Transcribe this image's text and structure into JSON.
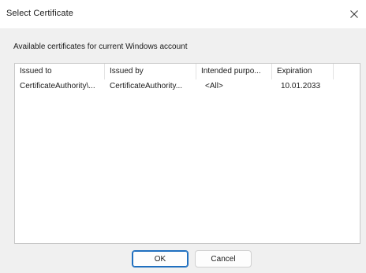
{
  "window": {
    "title": "Select Certificate",
    "close_icon": "close-icon"
  },
  "description": "Available certificates for current Windows account",
  "table": {
    "columns": [
      "Issued to",
      "Issued by",
      "Intended purpo...",
      "Expiration"
    ],
    "rows": [
      [
        "CertificateAuthority\\...",
        "CertificateAuthority...",
        "<All>",
        "10.01.2033"
      ]
    ]
  },
  "buttons": {
    "ok_label": "OK",
    "cancel_label": "Cancel"
  },
  "colors": {
    "accent": "#1f6fbf",
    "dialog_background": "#f0f0f0"
  }
}
